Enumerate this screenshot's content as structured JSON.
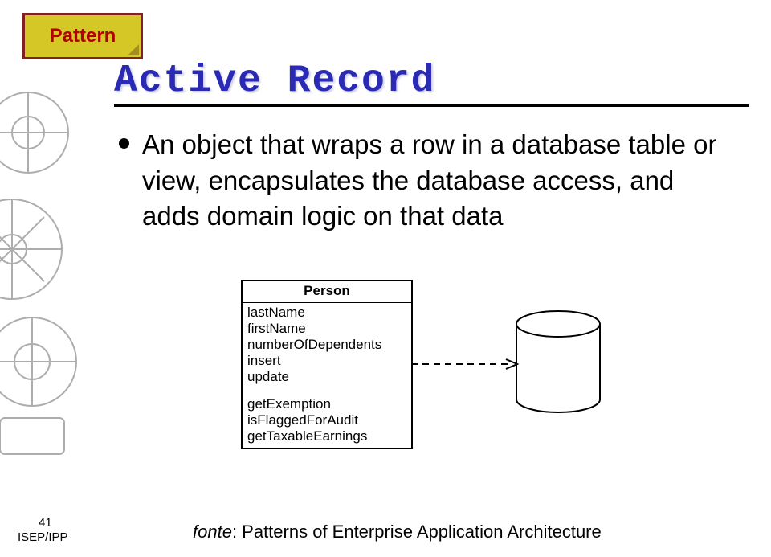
{
  "pattern_label": "Pattern",
  "title": "Active Record",
  "bullet": "An object that wraps a row in a database table or view, encapsulates the database access, and adds domain logic on that data",
  "uml": {
    "class_name": "Person",
    "attributes": [
      "lastName",
      "firstName",
      "numberOfDependents"
    ],
    "crud": [
      "insert",
      "update"
    ],
    "methods": [
      "getExemption",
      "isFlaggedForAudit",
      "getTaxableEarnings"
    ]
  },
  "footer": {
    "page_number": "41",
    "org": "ISEP/IPP",
    "fonte_label": "fonte",
    "fonte_text": ": Patterns of Enterprise Application Architecture"
  }
}
